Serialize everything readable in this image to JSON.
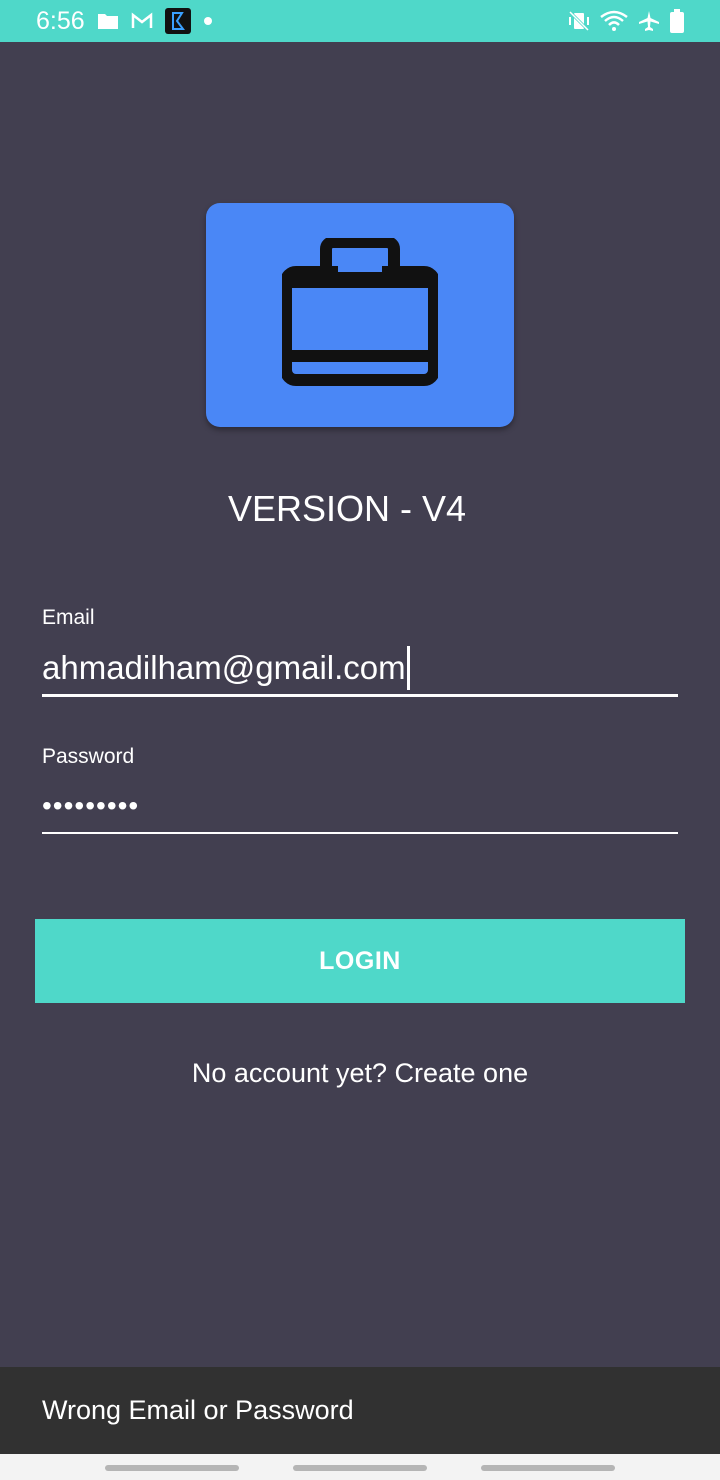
{
  "status_bar": {
    "time": "6:56",
    "left_icons": [
      "folder-icon",
      "gmail-icon",
      "app-notification-icon",
      "dot-icon"
    ],
    "right_icons": [
      "vibrate-off-icon",
      "wifi-icon",
      "airplane-icon",
      "battery-icon"
    ],
    "background": "#4fd8c9"
  },
  "logo": {
    "icon": "briefcase-icon",
    "background": "#4a87f6"
  },
  "version_text": "VERSION - V4",
  "form": {
    "email_label": "Email",
    "email_value": "ahmadilham@gmail.com",
    "password_label": "Password",
    "password_value": "•••••••••"
  },
  "login_button": "LOGIN",
  "create_account_link": "No account yet? Create one",
  "snackbar": {
    "message": "Wrong Email or Password"
  },
  "colors": {
    "background": "#423f50",
    "accent": "#4fd8c9",
    "snackbar": "#313131"
  }
}
